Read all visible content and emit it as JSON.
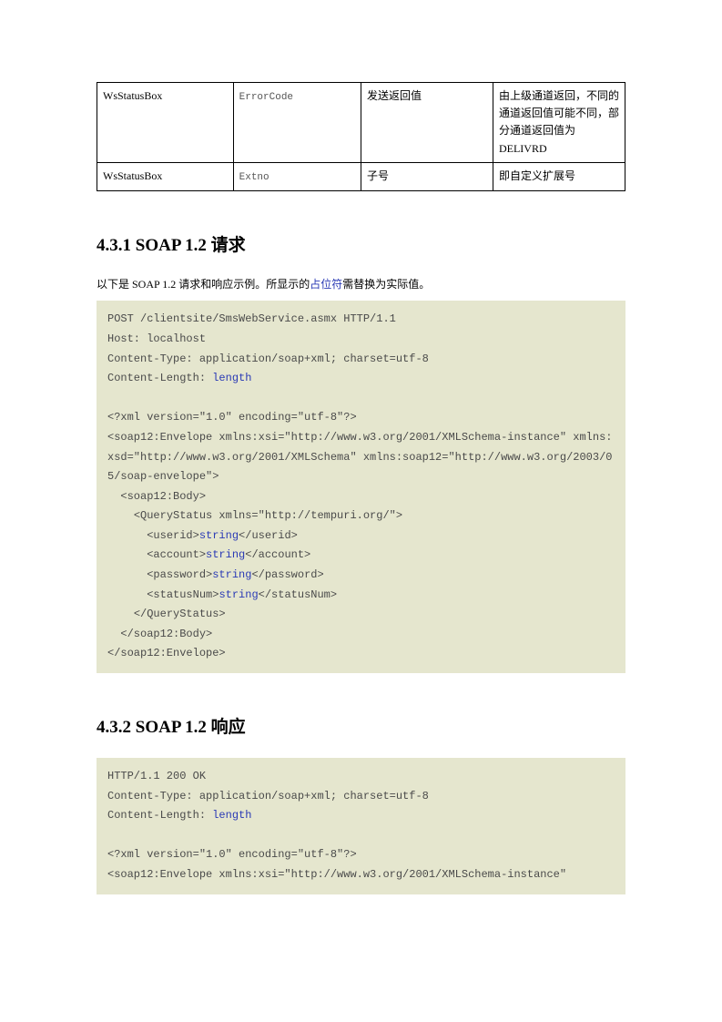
{
  "table": {
    "rows": [
      {
        "c1": "WsStatusBox",
        "c2": "ErrorCode",
        "c3": "发送返回值",
        "c4": "由上级通道返回，不同的通道返回值可能不同，部分通道返回值为 DELIVRD"
      },
      {
        "c1": "WsStatusBox",
        "c2": "Extno",
        "c3": "子号",
        "c4": "即自定义扩展号"
      }
    ]
  },
  "section1": {
    "heading": "4.3.1  SOAP 1.2 请求",
    "intro_prefix": "以下是 SOAP 1.2  请求和响应示例。所显示的",
    "intro_link": "占位符",
    "intro_suffix": "需替换为实际值。",
    "code": {
      "l1": "POST /clientsite/SmsWebService.asmx HTTP/1.1",
      "l2": "Host: localhost",
      "l3": "Content-Type: application/soap+xml; charset=utf-8",
      "l4a": "Content-Length: ",
      "l4b": "length",
      "l5": "",
      "l6": "<?xml version=\"1.0\" encoding=\"utf-8\"?>",
      "l7": "<soap12:Envelope xmlns:xsi=\"http://www.w3.org/2001/XMLSchema-instance\" xmlns:xsd=\"http://www.w3.org/2001/XMLSchema\" xmlns:soap12=\"http://www.w3.org/2003/05/soap-envelope\">",
      "l8": "  <soap12:Body>",
      "l9": "    <QueryStatus xmlns=\"http://tempuri.org/\">",
      "l10a": "      <userid>",
      "l10b": "string",
      "l10c": "</userid>",
      "l11a": "      <account>",
      "l11b": "string",
      "l11c": "</account>",
      "l12a": "      <password>",
      "l12b": "string",
      "l12c": "</password>",
      "l13a": "      <statusNum>",
      "l13b": "string",
      "l13c": "</statusNum>",
      "l14": "    </QueryStatus>",
      "l15": "  </soap12:Body>",
      "l16": "</soap12:Envelope>"
    }
  },
  "section2": {
    "heading": "4.3.2  SOAP 1.2 响应",
    "code": {
      "l1": "HTTP/1.1 200 OK",
      "l2": "Content-Type: application/soap+xml; charset=utf-8",
      "l3a": "Content-Length: ",
      "l3b": "length",
      "l4": "",
      "l5": "<?xml version=\"1.0\" encoding=\"utf-8\"?>",
      "l6": "<soap12:Envelope xmlns:xsi=\"http://www.w3.org/2001/XMLSchema-instance\" "
    }
  }
}
